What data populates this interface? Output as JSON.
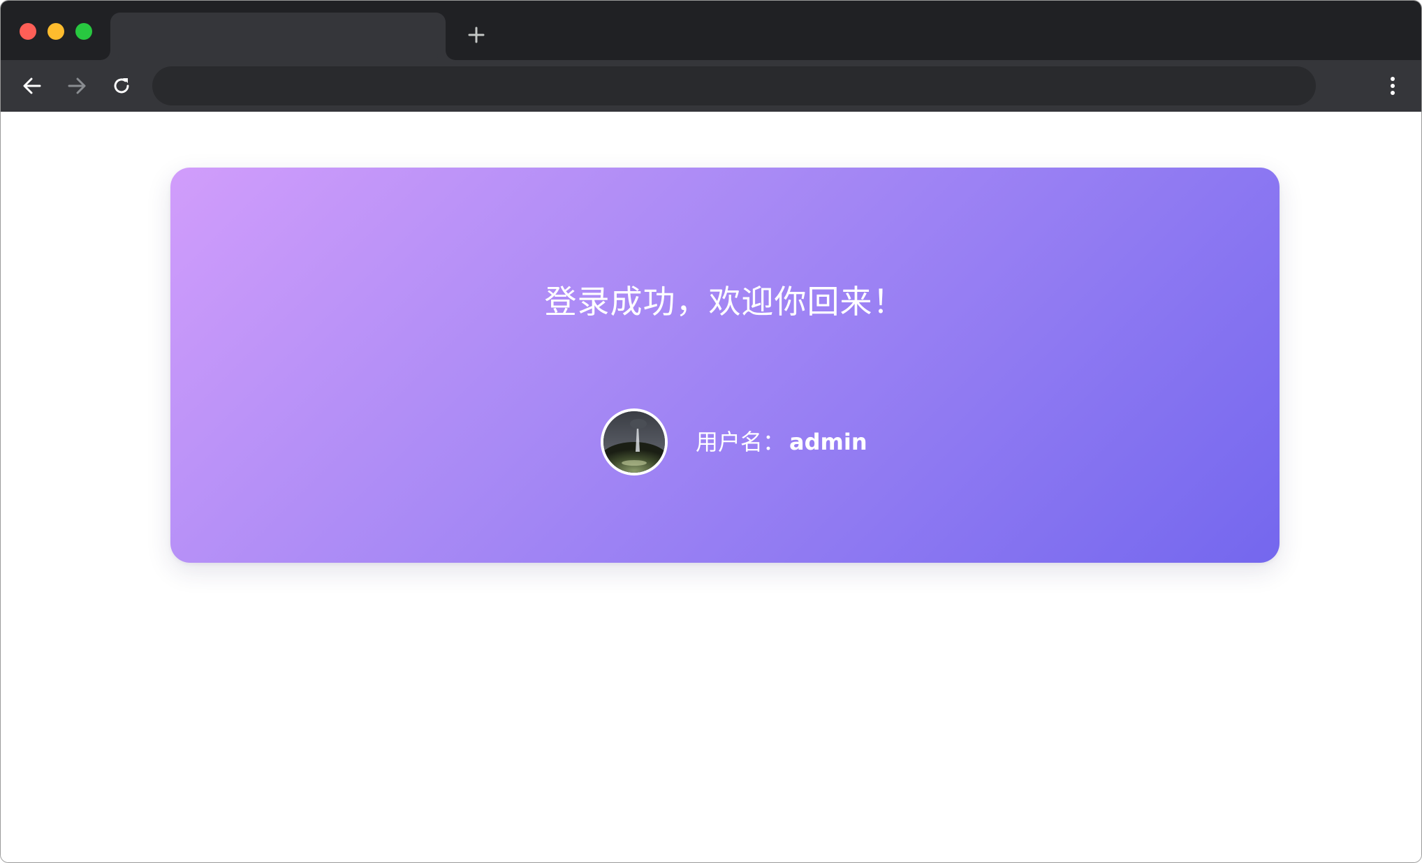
{
  "browser": {
    "tab_title": "",
    "new_tab_icon": "plus-icon",
    "address_value": "",
    "nav": {
      "back_icon": "arrow-left-icon",
      "forward_icon": "arrow-right-icon",
      "reload_icon": "reload-icon",
      "menu_icon": "kebab-menu-icon"
    },
    "colors": {
      "titlebar": "#202124",
      "toolbar": "#35363a",
      "close": "#fe5f57",
      "minimize": "#febc2e",
      "maximize": "#28c840"
    }
  },
  "page": {
    "welcome_text": "登录成功，欢迎你回来！",
    "username_label": "用户名：",
    "username_value": "admin",
    "avatar_icon": "user-avatar-image",
    "colors": {
      "card_gradient_start": "#d19dfb",
      "card_gradient_end": "#7467ee",
      "text": "#ffffff"
    }
  }
}
